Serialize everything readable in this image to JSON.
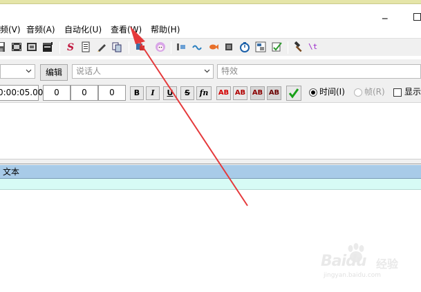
{
  "window": {
    "minimize_glyph": "_",
    "accent": "#e5e5a8"
  },
  "menu": [
    {
      "label": "频(V)"
    },
    {
      "label": "音频(A)"
    },
    {
      "label": "自动化(U)"
    },
    {
      "label": "查看(W)"
    },
    {
      "label": "帮助(H)"
    }
  ],
  "toolbar": {
    "icons": [
      "save-icon",
      "film-icon",
      "video-icon",
      "clapperboard-icon",
      "spell-check-icon",
      "document-icon",
      "pencil-icon",
      "copy-icon",
      "translate-icon",
      "character-icon",
      "keyframe-icon",
      "fish-icon",
      "arrow-icon",
      "stop-icon",
      "timer-icon",
      "kanji-icon",
      "checklist-icon",
      "hammer-icon",
      "automation-icon"
    ],
    "automation_label": "\\t"
  },
  "editor": {
    "style_combo_value": "",
    "edit_button": "编辑",
    "actor_placeholder": "说话人",
    "effect_placeholder": "特效",
    "end_time": "0:00:05.00",
    "margin_left": "0",
    "margin_right": "0",
    "margin_vertical": "0",
    "format_buttons": [
      "B",
      "I",
      "U",
      "S",
      "fn"
    ],
    "color_buttons": [
      "AB",
      "AB",
      "AB",
      "AB"
    ],
    "time_label": "时间(I)",
    "frame_label": "帧(R)",
    "show_label": "显示"
  },
  "grid": {
    "header_text": "文本"
  },
  "watermark": {
    "brand": "Baidu",
    "suffix": "经验",
    "url": "jingyan.baidu.com"
  },
  "annotation": {
    "arrow_color": "#e5393b"
  }
}
